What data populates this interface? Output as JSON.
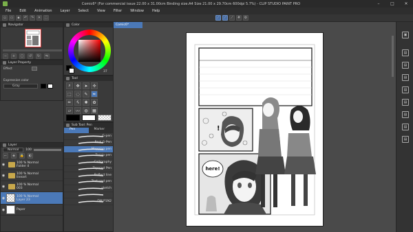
{
  "window": {
    "title": "Comic6* (For commercial issue 22.00 x 31.00cm Binding size:A4 Size 21.00 x 29.70cm 600dpi 5.7%) - CLIP STUDIO PAINT PRO",
    "minimize": "–",
    "maximize": "□",
    "close": "✕"
  },
  "menu": [
    "File",
    "Edit",
    "Animation",
    "Layer",
    "Select",
    "View",
    "Filter",
    "Window",
    "Help"
  ],
  "navigator": {
    "title": "Navigator"
  },
  "color_wheel": {
    "title": "Color",
    "value_readout": "37"
  },
  "layer_property": {
    "title": "Layer Property",
    "effect_label": "Effect",
    "expression_label": "Expression color",
    "expression_value": "Gray"
  },
  "tool": {
    "title": "Tool"
  },
  "subtool": {
    "title": "Sub Tool: Pen",
    "tab_pen": "Pen",
    "tab_marker": "Marker"
  },
  "brushes": [
    {
      "size": "",
      "name": "G-pen",
      "selected": false
    },
    {
      "size": "",
      "name": "Real G-Pen",
      "selected": false
    },
    {
      "size": "",
      "name": "Mapping pen",
      "selected": true
    },
    {
      "size": "",
      "name": "Turnip pen",
      "selected": false
    },
    {
      "size": "",
      "name": "Calligraphy",
      "selected": false
    },
    {
      "size": "",
      "name": "Tapered Pen",
      "selected": false
    },
    {
      "size": "",
      "name": "Reflect line",
      "selected": false
    },
    {
      "size": "",
      "name": "Textured pen",
      "selected": false
    },
    {
      "size": "",
      "name": "sketch",
      "selected": false
    },
    {
      "size": "",
      "name": "",
      "selected": false
    },
    {
      "size": "",
      "name": "DM P1N2",
      "selected": false
    }
  ],
  "layer_panel": {
    "title": "Layer",
    "blend_mode": "Normal",
    "opacity": "100",
    "layers": [
      {
        "line1": "100 % Normal",
        "line2": "Folder 4",
        "kind": "folder",
        "selected": false
      },
      {
        "line1": "100 % Normal",
        "line2": "lineart",
        "kind": "folder",
        "selected": false
      },
      {
        "line1": "100 % Normal",
        "line2": "003",
        "kind": "folder",
        "selected": false
      },
      {
        "line1": "100 % Normal",
        "line2": "Layer 23",
        "kind": "trans",
        "selected": true
      },
      {
        "line1": "",
        "line2": "Paper",
        "kind": "paper",
        "selected": false
      }
    ]
  },
  "document": {
    "tab": "Comic6*"
  },
  "comic": {
    "bubble_text": "here!",
    "exclaim": "!"
  },
  "colors": {
    "accent": "#4b79b8",
    "main_color": "#000000",
    "sub_color": "#ffffff"
  }
}
